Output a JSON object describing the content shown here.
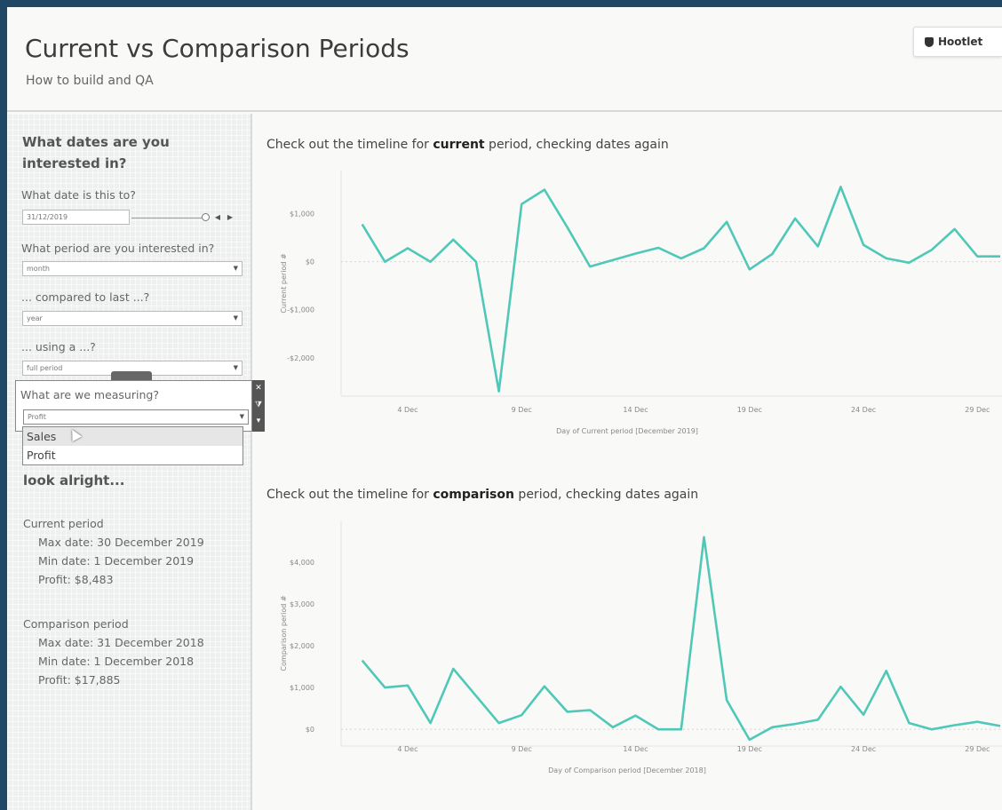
{
  "header": {
    "title": "Current vs Comparison Periods",
    "subtitle": "How to build and QA",
    "logo_text": "Hootlet"
  },
  "sidebar": {
    "question": "What dates are you interested in?",
    "date_label": "What date is this to?",
    "date_value": "31/12/2019",
    "period_label": "What period are you interested in?",
    "period_value": "month",
    "compare_label": "... compared to last ...?",
    "compare_value": "year",
    "using_label": "... using a ...?",
    "using_value": "full period",
    "measure_label": "What are we measuring?",
    "measure_value": "Profit",
    "measure_options": [
      "Sales",
      "Profit"
    ],
    "look_label": "look alright...",
    "current": {
      "title": "Current period",
      "max": "Max date: 30 December 2019",
      "min": "Min date: 1 December 2019",
      "profit": "Profit: $8,483"
    },
    "comparison": {
      "title": "Comparison period",
      "max": "Max date: 31 December 2018",
      "min": "Min date: 1 December 2018",
      "profit": "Profit: $17,885"
    }
  },
  "colors": {
    "line": "#4fc8b8",
    "accent_bg": "#1f4766"
  },
  "icons": {
    "close": "close-icon",
    "filter": "filter-icon",
    "more": "more-options-icon",
    "dropdown": "chevron-down-icon"
  },
  "chart_data": [
    {
      "type": "line",
      "title_pre": "Check out the timeline for ",
      "title_bold": "current",
      "title_post": " period, checking dates again",
      "xlabel": "Day of Current period [December 2019]",
      "ylabel": "Current period #",
      "xlim": [
        1,
        30
      ],
      "ylim": [
        -2800,
        1900
      ],
      "yticks": [
        1000,
        0,
        -1000,
        -2000
      ],
      "ytick_labels": [
        "$1,000",
        "$0",
        "-$1,000",
        "-$2,000"
      ],
      "xticks": [
        4,
        9,
        14,
        19,
        24,
        29
      ],
      "xtick_labels": [
        "4 Dec",
        "9 Dec",
        "14 Dec",
        "19 Dec",
        "24 Dec",
        "29 Dec"
      ],
      "x": [
        2,
        3,
        4,
        5,
        6,
        7,
        8,
        9,
        10,
        11,
        12,
        14,
        15,
        16,
        17,
        18,
        19,
        20,
        21,
        22,
        23,
        24,
        25,
        26,
        27,
        28,
        29,
        30
      ],
      "y": [
        780,
        0,
        280,
        0,
        460,
        0,
        -2700,
        1200,
        1500,
        720,
        -100,
        170,
        290,
        70,
        280,
        830,
        -160,
        160,
        900,
        320,
        1560,
        350,
        70,
        -20,
        250,
        680,
        110,
        110
      ],
      "grid": false
    },
    {
      "type": "line",
      "title_pre": "Check out the timeline for ",
      "title_bold": "comparison",
      "title_post": " period, checking dates again",
      "xlabel": "Day of Comparison period [December 2018]",
      "ylabel": "Comparison period #",
      "xlim": [
        1,
        30
      ],
      "ylim": [
        -400,
        5000
      ],
      "yticks": [
        4000,
        3000,
        2000,
        1000,
        0
      ],
      "ytick_labels": [
        "$4,000",
        "$3,000",
        "$2,000",
        "$1,000",
        "$0"
      ],
      "xticks": [
        4,
        9,
        14,
        19,
        24,
        29
      ],
      "xtick_labels": [
        "4 Dec",
        "9 Dec",
        "14 Dec",
        "19 Dec",
        "24 Dec",
        "29 Dec"
      ],
      "x": [
        2,
        3,
        4,
        5,
        6,
        8,
        9,
        10,
        11,
        12,
        13,
        14,
        15,
        16,
        17,
        18,
        19,
        20,
        21,
        22,
        23,
        24,
        25,
        26,
        27,
        28,
        29,
        30
      ],
      "y": [
        1650,
        1000,
        1050,
        150,
        1450,
        150,
        340,
        1030,
        420,
        460,
        50,
        330,
        0,
        0,
        4600,
        700,
        -250,
        50,
        130,
        230,
        1020,
        350,
        1400,
        150,
        0,
        100,
        180,
        80
      ],
      "grid": false
    }
  ]
}
